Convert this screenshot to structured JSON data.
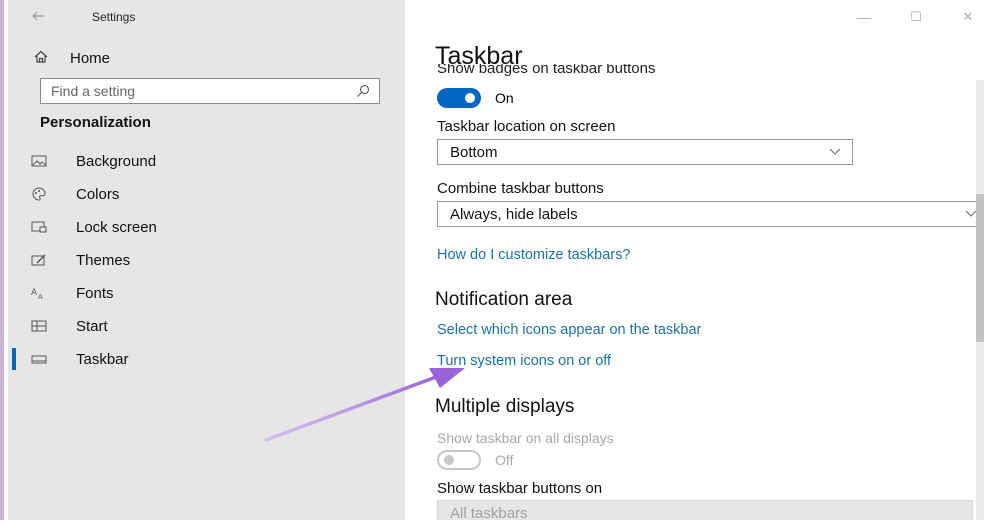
{
  "window": {
    "title": "Settings",
    "controls": {
      "minimize": "—",
      "maximize": "☐",
      "close": "✕"
    }
  },
  "sidebar": {
    "back_icon": "back-arrow-icon",
    "home": {
      "label": "Home",
      "icon": "home-icon"
    },
    "search": {
      "placeholder": "Find a setting",
      "icon": "search-icon"
    },
    "section": "Personalization",
    "items": [
      {
        "label": "Background",
        "icon": "picture-icon",
        "active": false
      },
      {
        "label": "Colors",
        "icon": "palette-icon",
        "active": false
      },
      {
        "label": "Lock screen",
        "icon": "lock-screen-icon",
        "active": false
      },
      {
        "label": "Themes",
        "icon": "brush-icon",
        "active": false
      },
      {
        "label": "Fonts",
        "icon": "font-icon",
        "active": false
      },
      {
        "label": "Start",
        "icon": "start-icon",
        "active": false
      },
      {
        "label": "Taskbar",
        "icon": "taskbar-icon",
        "active": true
      }
    ],
    "accent_color": "#0067c0"
  },
  "main": {
    "title": "Taskbar",
    "badges_label": "Show badges on taskbar buttons",
    "badges_toggle": {
      "state": "On"
    },
    "location": {
      "label": "Taskbar location on screen",
      "value": "Bottom"
    },
    "combine": {
      "label": "Combine taskbar buttons",
      "value": "Always, hide labels"
    },
    "customize_link": "How do I customize taskbars?",
    "notification_area": {
      "heading": "Notification area",
      "link_icons": "Select which icons appear on the taskbar",
      "link_system": "Turn system icons on or off"
    },
    "multiple_displays": {
      "heading": "Multiple displays",
      "show_all_label": "Show taskbar on all displays",
      "show_all_toggle": {
        "state": "Off"
      },
      "buttons_on_label": "Show taskbar buttons on",
      "buttons_on_value": "All taskbars"
    },
    "link_color": "#1a73a8"
  },
  "annotation": {
    "arrow_color": "#a875e0",
    "icon": "annotation-arrow"
  }
}
